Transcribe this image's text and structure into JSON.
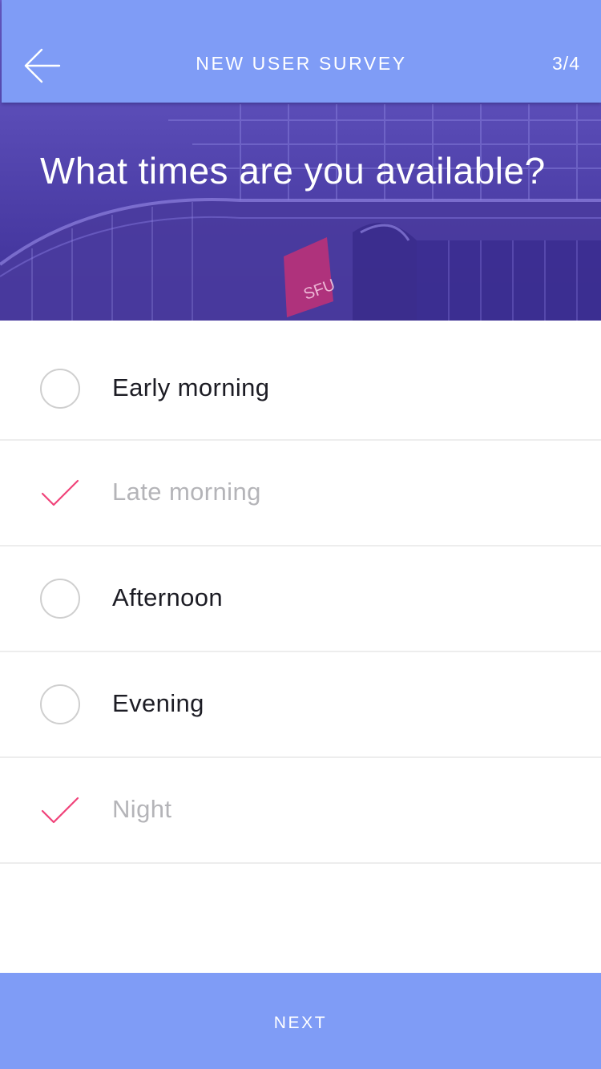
{
  "nav": {
    "back_icon": "arrow-left-icon",
    "title": "NEW USER SURVEY",
    "step": "3/4"
  },
  "hero": {
    "question": "What times are you available?",
    "sign_text": "SFU"
  },
  "options": [
    {
      "label": "Early morning",
      "checked": false
    },
    {
      "label": "Late morning",
      "checked": true
    },
    {
      "label": "Afternoon",
      "checked": false
    },
    {
      "label": "Evening",
      "checked": false
    },
    {
      "label": "Night",
      "checked": true
    }
  ],
  "footer": {
    "next_label": "NEXT"
  },
  "colors": {
    "accent": "#7f9cf6",
    "check": "#f0437a",
    "hero_overlay": "#4a3aa8"
  }
}
